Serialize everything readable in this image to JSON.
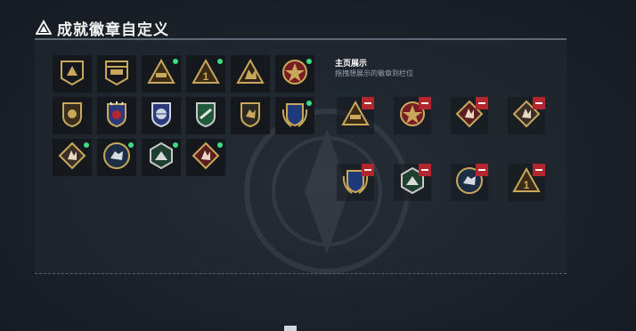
{
  "window": {
    "title": "成就徽章自定义",
    "title_icon": "triangle-warning-icon"
  },
  "showcase": {
    "title": "主页展示",
    "subtitle": "拖拽想展示的徽章到栏位"
  },
  "colors": {
    "gold": "#c9a85c",
    "remove_red": "#b4262d",
    "new_dot": "#3ddc84",
    "panel_border": "#5d6a76"
  },
  "badges": [
    {
      "icon": "rank-chevron-badge-icon",
      "new": false
    },
    {
      "icon": "helicopter-badge-icon",
      "new": false
    },
    {
      "icon": "tank-triangle-badge-icon",
      "new": true
    },
    {
      "icon": "number-one-triangle-badge-icon",
      "new": true
    },
    {
      "icon": "wolf-triangle-badge-icon",
      "new": false
    },
    {
      "icon": "star-cross-medal-icon",
      "new": true
    },
    {
      "icon": "eagle-shield-badge-icon",
      "new": false
    },
    {
      "icon": "star-shield-medal-icon",
      "new": false
    },
    {
      "icon": "globe-shield-medal-icon",
      "new": false
    },
    {
      "icon": "green-shield-badge-icon",
      "new": false
    },
    {
      "icon": "beast-shield-badge-icon",
      "new": false
    },
    {
      "icon": "laurel-shield-medal-icon",
      "new": true
    },
    {
      "icon": "beast-diamond-badge-icon",
      "new": true
    },
    {
      "icon": "wolf-circle-badge-icon",
      "new": true
    },
    {
      "icon": "dragon-hex-badge-icon",
      "new": true
    },
    {
      "icon": "beast-diamond-red-badge-icon",
      "new": true
    }
  ],
  "slots": [
    {
      "icon": "tank-triangle-badge-icon"
    },
    {
      "icon": "star-cross-medal-icon"
    },
    {
      "icon": "beast-diamond-red-badge-icon"
    },
    {
      "icon": "beast-diamond-badge-icon"
    },
    {
      "icon": "laurel-shield-medal-icon"
    },
    {
      "icon": "dragon-hex-badge-icon"
    },
    {
      "icon": "wolf-circle-badge-icon"
    },
    {
      "icon": "number-one-triangle-badge-icon"
    }
  ]
}
